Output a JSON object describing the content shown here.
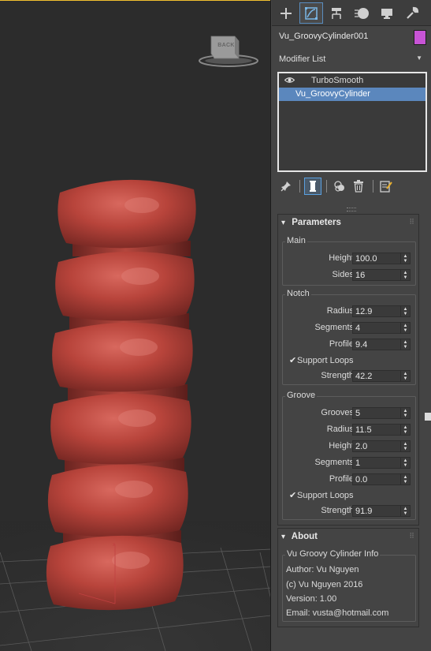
{
  "viewport": {
    "viewcube_face": "BACK",
    "object_color": "#b13c34"
  },
  "command_panel": {
    "tabs": [
      {
        "name": "create",
        "icon": "plus-icon"
      },
      {
        "name": "modify",
        "icon": "modify-icon",
        "active": true
      },
      {
        "name": "hierarchy",
        "icon": "hierarchy-icon"
      },
      {
        "name": "motion",
        "icon": "motion-icon"
      },
      {
        "name": "display",
        "icon": "display-icon"
      },
      {
        "name": "utilities",
        "icon": "wrench-icon"
      }
    ],
    "object_name": "Vu_GroovyCylinder001",
    "object_color": "#c854d6",
    "modifier_list_label": "Modifier List",
    "stack": [
      {
        "label": "TurboSmooth",
        "visible": true,
        "selected": false
      },
      {
        "label": "Vu_GroovyCylinder",
        "selected": true
      }
    ]
  },
  "parameters": {
    "title": "Parameters",
    "main": {
      "title": "Main",
      "fields": [
        {
          "label": "Height",
          "value": "100.0"
        },
        {
          "label": "Sides",
          "value": "16"
        }
      ]
    },
    "notch": {
      "title": "Notch",
      "fields": [
        {
          "label": "Radius",
          "value": "12.9"
        },
        {
          "label": "Segments",
          "value": "4"
        },
        {
          "label": "Profile",
          "value": "9.4"
        }
      ],
      "support_loops": {
        "label": "Support Loops",
        "checked": true
      },
      "strength": {
        "label": "Strength",
        "value": "42.2"
      }
    },
    "groove": {
      "title": "Groove",
      "fields": [
        {
          "label": "Grooves",
          "value": "5"
        },
        {
          "label": "Radius",
          "value": "11.5"
        },
        {
          "label": "Height",
          "value": "2.0"
        },
        {
          "label": "Segments",
          "value": "1"
        },
        {
          "label": "Profile",
          "value": "0.0"
        }
      ],
      "support_loops": {
        "label": "Support Loops",
        "checked": true
      },
      "strength": {
        "label": "Strength",
        "value": "91.9"
      }
    }
  },
  "about": {
    "title": "About",
    "group_title": "Vu Groovy Cylinder Info",
    "lines": [
      "Author: Vu Nguyen",
      "(c) Vu Nguyen 2016",
      "Version: 1.00",
      "Email: vusta@hotmail.com"
    ]
  }
}
